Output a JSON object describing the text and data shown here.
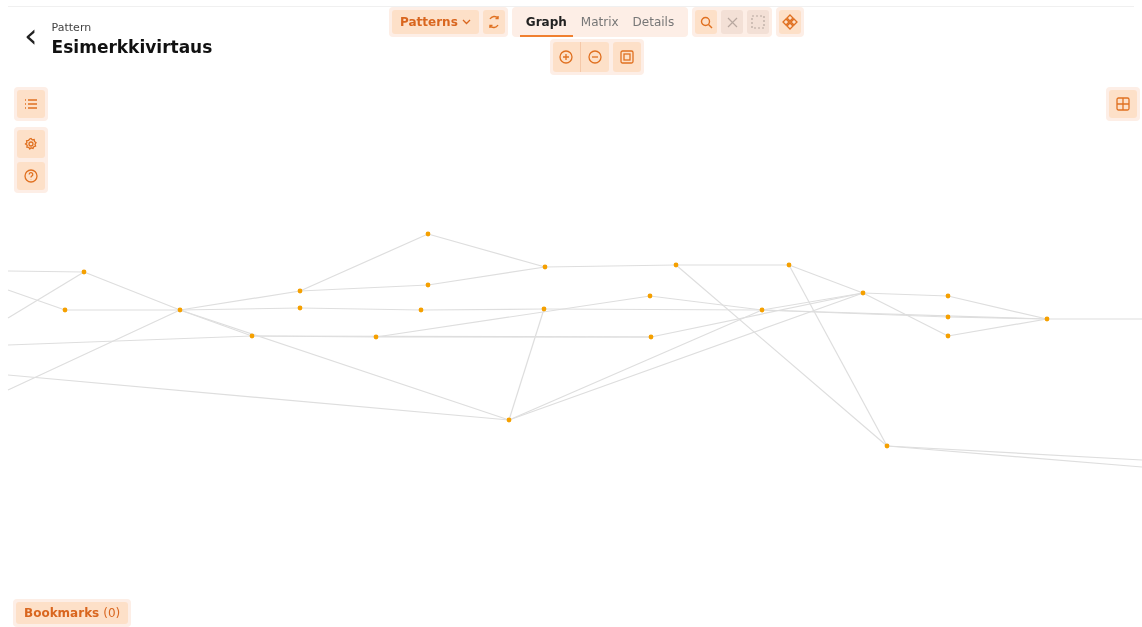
{
  "header": {
    "back": "‹",
    "subtitle": "Pattern",
    "title": "Esimerkkivirtaus"
  },
  "toolbar": {
    "patterns_button": "Patterns",
    "view_tabs": [
      {
        "label": "Graph",
        "selected": true
      },
      {
        "label": "Matrix",
        "selected": false
      },
      {
        "label": "Details",
        "selected": false
      }
    ],
    "tools": [
      {
        "kind": "search",
        "disabled": false
      },
      {
        "kind": "clear",
        "disabled": true
      },
      {
        "kind": "select",
        "disabled": true
      }
    ]
  },
  "bookmarks": {
    "label": "Bookmarks",
    "count": "(0)"
  }
}
